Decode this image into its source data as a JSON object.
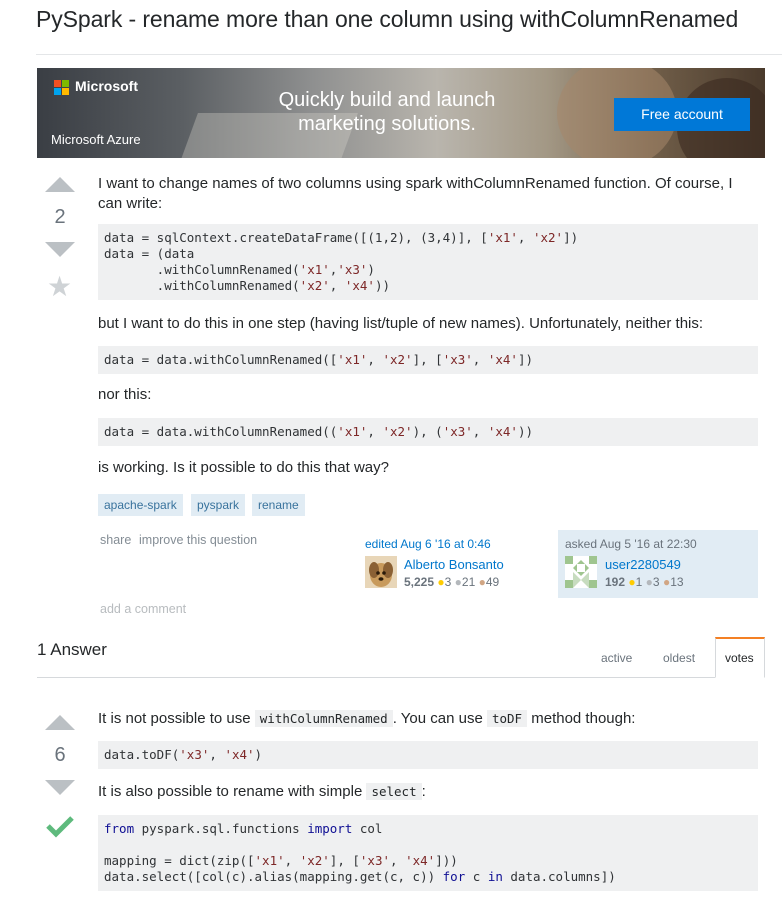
{
  "question": {
    "title": "PySpark - rename more than one column using withColumnRenamed",
    "votes": "2",
    "para1_a": "I want to change names of two columns using spark withColumnRenamed function. Of course, I",
    "para1_b": "can write:",
    "code1_l1_a": "data = sqlContext.createDataFrame([(1,2), (3,4)], [",
    "code1_l1_s1": "'x1'",
    "code1_l1_b": ", ",
    "code1_l1_s2": "'x2'",
    "code1_l1_c": "])",
    "code1_l2": "data = (data",
    "code1_l3_a": "       .withColumnRenamed(",
    "code1_l3_s1": "'x1'",
    "code1_l3_b": ",",
    "code1_l3_s2": "'x3'",
    "code1_l3_c": ")",
    "code1_l4_a": "       .withColumnRenamed(",
    "code1_l4_s1": "'x2'",
    "code1_l4_b": ", ",
    "code1_l4_s2": "'x4'",
    "code1_l4_c": "))",
    "para2": "but I want to do this in one step (having list/tuple of new names). Unfortunately, neither this:",
    "code2_a": "data = data.withColumnRenamed([",
    "code2_s1": "'x1'",
    "code2_b": ", ",
    "code2_s2": "'x2'",
    "code2_c": "], [",
    "code2_s3": "'x3'",
    "code2_d": ", ",
    "code2_s4": "'x4'",
    "code2_e": "])",
    "para3": "nor this:",
    "code3_a": "data = data.withColumnRenamed((",
    "code3_s1": "'x1'",
    "code3_b": ", ",
    "code3_s2": "'x2'",
    "code3_c": "), (",
    "code3_s3": "'x3'",
    "code3_d": ", ",
    "code3_s4": "'x4'",
    "code3_e": "))",
    "para4": "is working. Is it possible to do this that way?",
    "tags": [
      "apache-spark",
      "pyspark",
      "rename"
    ],
    "share": "share",
    "improve": "improve this question",
    "edited_label": "edited Aug 6 '16 at 0:46",
    "editor_name": "Alberto Bonsanto",
    "editor_rep": "5,225",
    "editor_gold": "3",
    "editor_silver": "21",
    "editor_bronze": "49",
    "asked_label": "asked Aug 5 '16 at 22:30",
    "asker_name": "user2280549",
    "asker_rep": "192",
    "asker_gold": "1",
    "asker_silver": "3",
    "asker_bronze": "13",
    "add_comment": "add a comment"
  },
  "ad": {
    "brand": "Microsoft",
    "product": "Microsoft Azure",
    "headline_1": "Quickly build and launch",
    "headline_2": "marketing solutions.",
    "cta": "Free account",
    "logo_colors": [
      "#f25022",
      "#7fba00",
      "#00a4ef",
      "#ffb900"
    ]
  },
  "answers": {
    "header": "1 Answer",
    "tabs": [
      "active",
      "oldest",
      "votes"
    ],
    "active_tab": "votes"
  },
  "answer": {
    "votes": "6",
    "accepted": true,
    "p1_a": "It is not possible to use ",
    "p1_code1": "withColumnRenamed",
    "p1_b": ". You can use ",
    "p1_code2": "toDF",
    "p1_c": " method though:",
    "code1_a": "data.toDF(",
    "code1_s1": "'x3'",
    "code1_b": ", ",
    "code1_s2": "'x4'",
    "code1_c": ")",
    "p2_a": "It is also possible to rename with simple ",
    "p2_code": "select",
    "p2_b": ":",
    "code2_l1_kw1": "from",
    "code2_l1_a": " pyspark.sql.functions ",
    "code2_l1_kw2": "import",
    "code2_l1_b": " col",
    "code2_l3_a": "mapping = dict(zip([",
    "code2_l3_s1": "'x1'",
    "code2_l3_b": ", ",
    "code2_l3_s2": "'x2'",
    "code2_l3_c": "], [",
    "code2_l3_s3": "'x3'",
    "code2_l3_d": ", ",
    "code2_l3_s4": "'x4'",
    "code2_l3_e": "]))",
    "code2_l4_a": "data.select([col(c).alias(mapping.get(c, c)) ",
    "code2_l4_kw1": "for",
    "code2_l4_b": " c ",
    "code2_l4_kw2": "in",
    "code2_l4_c": " data.columns])"
  },
  "colors": {
    "accent": "#f48024",
    "link": "#0077cc",
    "tag_bg": "#e1ecf4",
    "accepted": "#5eba7d"
  }
}
